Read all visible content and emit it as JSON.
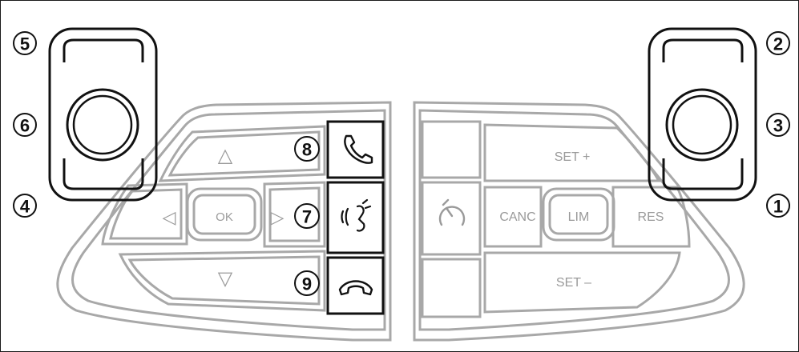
{
  "callouts": {
    "c1": "1",
    "c2": "2",
    "c3": "3",
    "c4": "4",
    "c5": "5",
    "c6": "6",
    "c7": "7",
    "c8": "8",
    "c9": "9"
  },
  "left_pad": {
    "ok_label": "OK",
    "up_glyph": "△",
    "down_glyph": "▽",
    "left_glyph": "◁",
    "right_glyph": "▷"
  },
  "right_pad": {
    "set_plus": "SET +",
    "set_minus": "SET –",
    "canc": "CANC",
    "lim": "LIM",
    "res": "RES"
  },
  "icons": [
    "phone-answer-icon",
    "voice-command-icon",
    "phone-hangup-icon",
    "speedometer-icon",
    "scroll-wheel-icon"
  ],
  "colors": {
    "outline_gray": "#a8a8a8",
    "highlight_black": "#111111"
  }
}
